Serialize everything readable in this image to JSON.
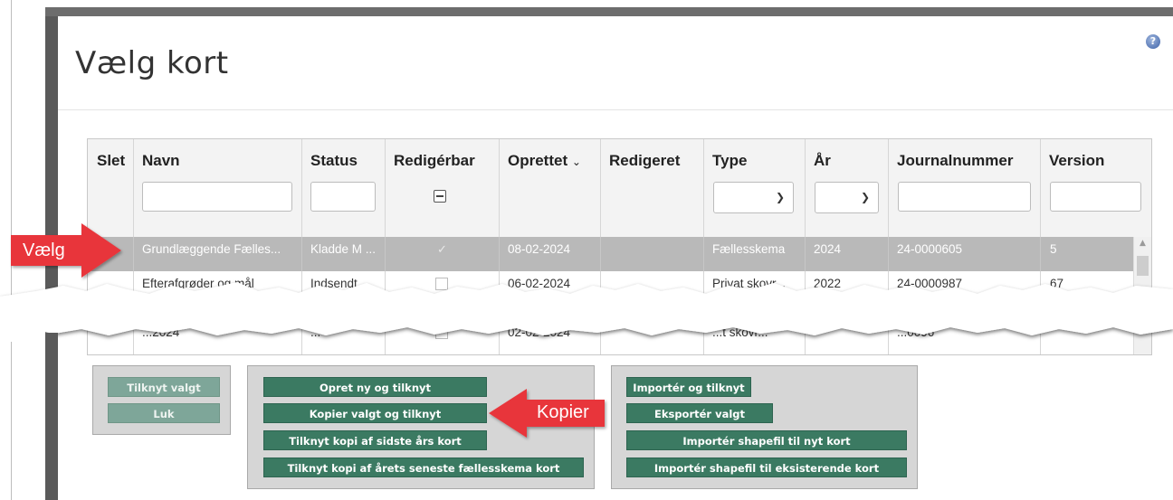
{
  "dialog": {
    "title": "Vælg kort",
    "help_icon": "question-icon"
  },
  "grid": {
    "columns": [
      {
        "key": "slet",
        "label": "Slet"
      },
      {
        "key": "navn",
        "label": "Navn"
      },
      {
        "key": "status",
        "label": "Status"
      },
      {
        "key": "redigerbar",
        "label": "Redigérbar"
      },
      {
        "key": "oprettet",
        "label": "Oprettet",
        "sort_icon": "⌄"
      },
      {
        "key": "redigeret",
        "label": "Redigeret"
      },
      {
        "key": "type",
        "label": "Type"
      },
      {
        "key": "aar",
        "label": "År"
      },
      {
        "key": "journalnummer",
        "label": "Journalnummer"
      },
      {
        "key": "version",
        "label": "Version"
      }
    ],
    "rows": [
      {
        "navn": "Grundlæggende Fælles...",
        "status": "Kladde M ...",
        "redigerbar": "✓",
        "oprettet": "08-02-2024",
        "redigeret": "",
        "type": "Fællesskema",
        "aar": "2024",
        "journalnummer": "24-0000605",
        "version": "5"
      },
      {
        "navn": "Efterafgrøder og mål",
        "status": "Indsendt ...",
        "redigerbar": "",
        "oprettet": "06-02-2024",
        "redigeret": "",
        "type": "Privat skovr...",
        "aar": "2022",
        "journalnummer": "24-0000987",
        "version": "67"
      },
      {
        "navn": "...2024",
        "status": "...",
        "redigerbar": "",
        "oprettet": "02-02-2024",
        "redigeret": "",
        "type": "...t skovr...",
        "aar": "",
        "journalnummer": "...0096",
        "version": ""
      }
    ]
  },
  "panels": {
    "left": {
      "buttons": [
        "Tilknyt valgt",
        "Luk"
      ]
    },
    "middle": {
      "buttons": [
        "Opret ny og tilknyt",
        "Kopier valgt og tilknyt",
        "Tilknyt kopi af sidste års kort",
        "Tilknyt kopi af årets seneste fællesskema kort"
      ]
    },
    "right": {
      "buttons": [
        "Importér og tilknyt",
        "Eksportér valgt",
        "Importér shapefil til nyt kort",
        "Importér shapefil til eksisterende kort"
      ]
    }
  },
  "annotations": {
    "select_label": "Vælg",
    "copy_label": "Kopier",
    "color": "#e8353b"
  },
  "colors": {
    "button": "#3b7a62",
    "selected_row": "#b9b9b9",
    "panel": "#d6d6d6"
  }
}
